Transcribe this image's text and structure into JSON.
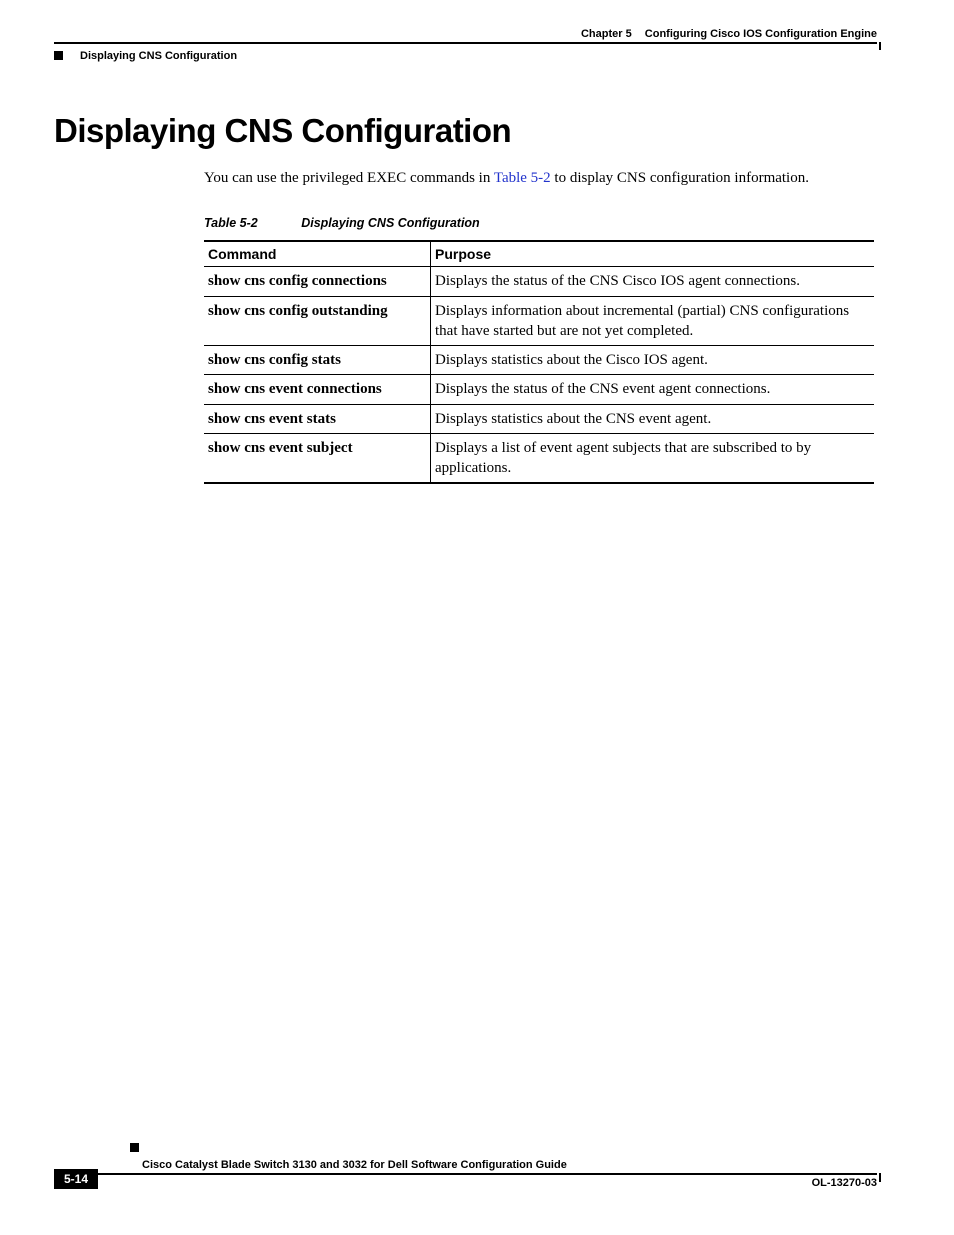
{
  "header": {
    "chapter_label": "Chapter 5",
    "chapter_title": "Configuring Cisco IOS Configuration Engine",
    "section": "Displaying CNS Configuration"
  },
  "heading": "Displaying CNS Configuration",
  "intro_pre": "You can use the privileged EXEC commands in ",
  "intro_link": "Table 5-2",
  "intro_post": " to display CNS configuration information.",
  "table": {
    "number": "Table 5-2",
    "title": "Displaying CNS Configuration",
    "col1": "Command",
    "col2": "Purpose",
    "rows": [
      {
        "cmd": "show cns config connections",
        "purpose": "Displays the status of the CNS Cisco IOS agent connections."
      },
      {
        "cmd": "show cns config outstanding",
        "purpose": "Displays information about incremental (partial) CNS configurations that have started but are not yet completed."
      },
      {
        "cmd": "show cns config stats",
        "purpose": "Displays statistics about the Cisco IOS agent."
      },
      {
        "cmd": "show cns event connections",
        "purpose": "Displays the status of the CNS event agent connections."
      },
      {
        "cmd": "show cns event stats",
        "purpose": "Displays statistics about the CNS event agent."
      },
      {
        "cmd": "show cns event subject",
        "purpose": "Displays a list of event agent subjects that are subscribed to by applications."
      }
    ]
  },
  "footer": {
    "book": "Cisco Catalyst Blade Switch 3130 and 3032 for Dell Software Configuration Guide",
    "page": "5-14",
    "docid": "OL-13270-03"
  }
}
